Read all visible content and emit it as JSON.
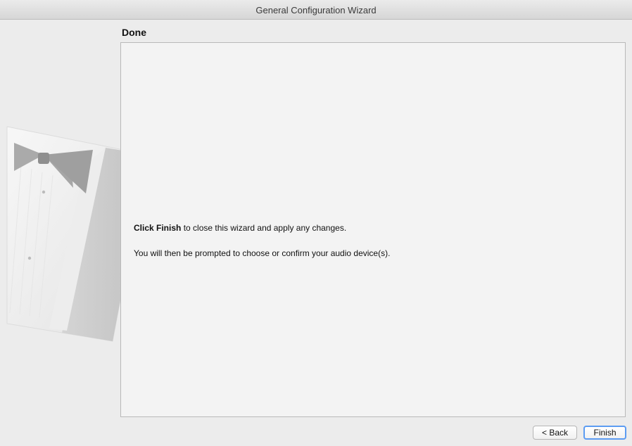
{
  "window": {
    "title": "General Configuration Wizard"
  },
  "page": {
    "heading": "Done"
  },
  "content": {
    "line1_bold": "Click Finish",
    "line1_rest": " to close this wizard and apply any changes.",
    "line2": "You will then be prompted to choose or confirm your audio device(s)."
  },
  "buttons": {
    "back": "< Back",
    "finish": "Finish"
  },
  "colors": {
    "default_button_border": "#5c9cf2",
    "panel_bg": "#f3f3f3",
    "window_bg": "#ececec"
  },
  "icons": {
    "side_art": "tuxedo-bowtie-icon"
  }
}
